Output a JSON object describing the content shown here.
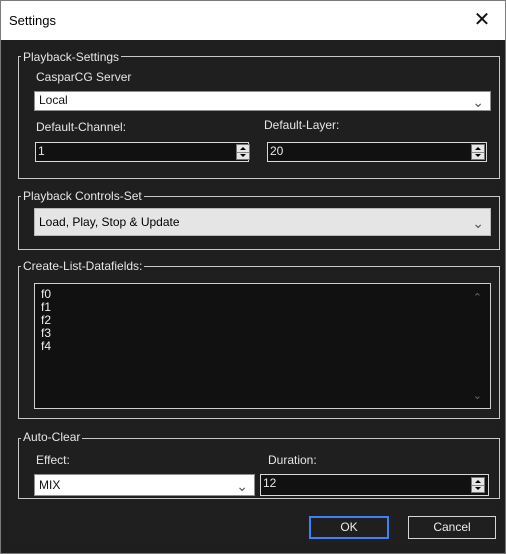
{
  "window": {
    "title": "Settings"
  },
  "playback_settings": {
    "legend": "Playback-Settings",
    "server_label": "CasparCG Server",
    "server_value": "Local",
    "channel_label": "Default-Channel:",
    "channel_value": "1",
    "layer_label": "Default-Layer:",
    "layer_value": "20"
  },
  "controls_set": {
    "legend": "Playback Controls-Set",
    "value": "Load, Play, Stop & Update"
  },
  "datafields": {
    "legend": "Create-List-Datafields:",
    "items": [
      "f0",
      "f1",
      "f2",
      "f3",
      "f4"
    ]
  },
  "auto_clear": {
    "legend": "Auto-Clear",
    "effect_label": "Effect:",
    "effect_value": "MIX",
    "duration_label": "Duration:",
    "duration_value": "12"
  },
  "buttons": {
    "ok": "OK",
    "cancel": "Cancel"
  },
  "icons": {
    "close": "close-icon",
    "chevron": "chevron-down-icon",
    "spin": "spin-arrows-icon"
  }
}
